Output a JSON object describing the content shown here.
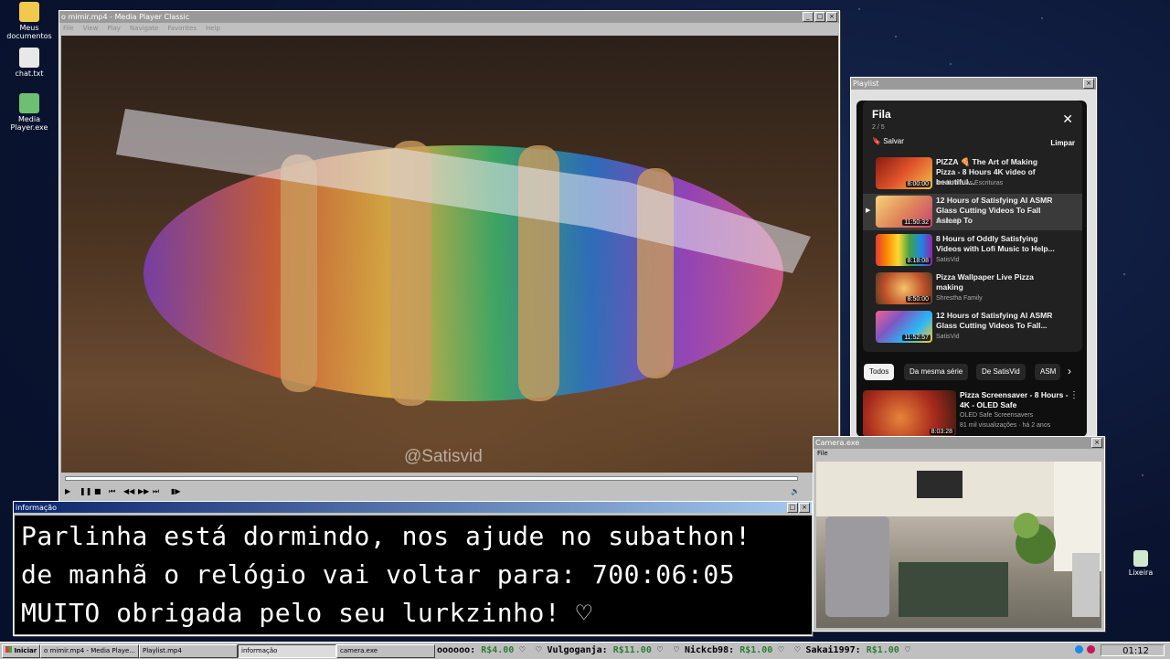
{
  "desktop": {
    "icons": [
      {
        "label": "Meus documentos",
        "color": "#f2c94c"
      },
      {
        "label": "chat.txt",
        "color": "#e8e8e8"
      },
      {
        "label": "Media Player.exe",
        "color": "#6fbf73"
      },
      {
        "label": "Lixeira",
        "color": "#cfe8cf"
      }
    ]
  },
  "mpc": {
    "title": "o mimir.mp4 - Media Player Classic",
    "menu": [
      "File",
      "View",
      "Play",
      "Navigate",
      "Favorites",
      "Help"
    ],
    "watermark": "@Satisvid",
    "progress": 0.0
  },
  "playlist_window": {
    "title": "Playlist",
    "header": "Fila",
    "count": "2 / 5",
    "save_label": "Salvar",
    "clear_label": "Limpar",
    "items": [
      {
        "title": "PIZZA 🍕 The Art of Making Pizza - 8 Hours 4K video of beautiful...",
        "channel": "Jardín de las Escrituras",
        "duration": "8:00:00",
        "active": false
      },
      {
        "title": "12 Hours of Satisfying AI ASMR Glass Cutting Videos To Fall Asleep To",
        "channel": "SatisVid",
        "duration": "11:50:32",
        "active": true
      },
      {
        "title": "8 Hours of Oddly Satisfying Videos with Lofi Music to Help...",
        "channel": "SatisVid",
        "duration": "8:18:08",
        "active": false
      },
      {
        "title": "Pizza Wallpaper Live Pizza making",
        "channel": "Shrestha Family",
        "duration": "8:50:00",
        "active": false
      },
      {
        "title": "12 Hours of Satisfying AI ASMR Glass Cutting Videos To Fall...",
        "channel": "SatisVid",
        "duration": "11:52:57",
        "active": false
      }
    ],
    "chips": [
      "Todos",
      "Da mesma série",
      "De SatisVid",
      "ASM"
    ],
    "recommended": {
      "title": "Pizza Screensaver - 8 Hours - 4K - OLED Safe",
      "channel": "OLED Safe Screensavers",
      "meta": "81 mil visualizações · há 2 anos",
      "duration": "8:03:28"
    }
  },
  "info_window": {
    "title": "informação",
    "lines": [
      "Parlinha está dormindo, nos ajude no subathon!",
      "de manhã o relógio vai voltar para:  700:06:05",
      "MUITO obrigada pelo seu lurkzinho! ♡"
    ]
  },
  "camera_window": {
    "title": "Camera.exe",
    "menu": "File"
  },
  "taskbar": {
    "start": "Iniciar",
    "tasks": [
      "o mimir.mp4 - Media Playe...",
      "Playlist.mp4",
      "informação",
      "camera.exe"
    ],
    "ticker": [
      {
        "name": "oooooo:",
        "amount": "R$4.00"
      },
      {
        "name": "Vulgoganja:",
        "amount": "R$11.00"
      },
      {
        "name": "Nickcb98:",
        "amount": "R$1.00"
      },
      {
        "name": "Sakai1997:",
        "amount": "R$1.00"
      }
    ],
    "clock": "01:12"
  }
}
